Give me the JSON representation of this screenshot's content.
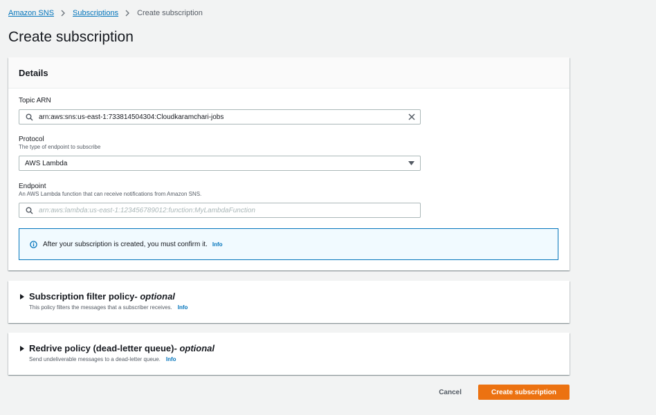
{
  "breadcrumb": {
    "items": [
      "Amazon SNS",
      "Subscriptions"
    ],
    "current": "Create subscription"
  },
  "page_title": "Create subscription",
  "details": {
    "title": "Details",
    "topic_arn": {
      "label": "Topic ARN",
      "value": "arn:aws:sns:us-east-1:733814504304:Cloudkaramchari-jobs"
    },
    "protocol": {
      "label": "Protocol",
      "description": "The type of endpoint to subscribe",
      "value": "AWS Lambda"
    },
    "endpoint": {
      "label": "Endpoint",
      "description": "An AWS Lambda function that can receive notifications from Amazon SNS.",
      "placeholder": "arn:aws:lambda:us-east-1:123456789012:function:MyLambdaFunction"
    },
    "alert": {
      "text": "After your subscription is created, you must confirm it.",
      "info": "Info"
    }
  },
  "filter_policy": {
    "title": "Subscription filter policy",
    "optional": " - optional",
    "description": "This policy filters the messages that a subscriber receives.",
    "info": "Info"
  },
  "redrive_policy": {
    "title": "Redrive policy (dead-letter queue)",
    "optional": " - optional",
    "description": "Send undeliverable messages to a dead-letter queue.",
    "info": "Info"
  },
  "actions": {
    "cancel": "Cancel",
    "create": "Create subscription"
  },
  "colors": {
    "link": "#0073bb",
    "primary": "#ec7211",
    "background": "#f2f3f3",
    "alert_bg": "#f1faff"
  },
  "icons": [
    "chevron-right-icon",
    "search-icon",
    "clear-icon",
    "caret-down-icon",
    "info-circle-icon",
    "expand-triangle-icon"
  ]
}
